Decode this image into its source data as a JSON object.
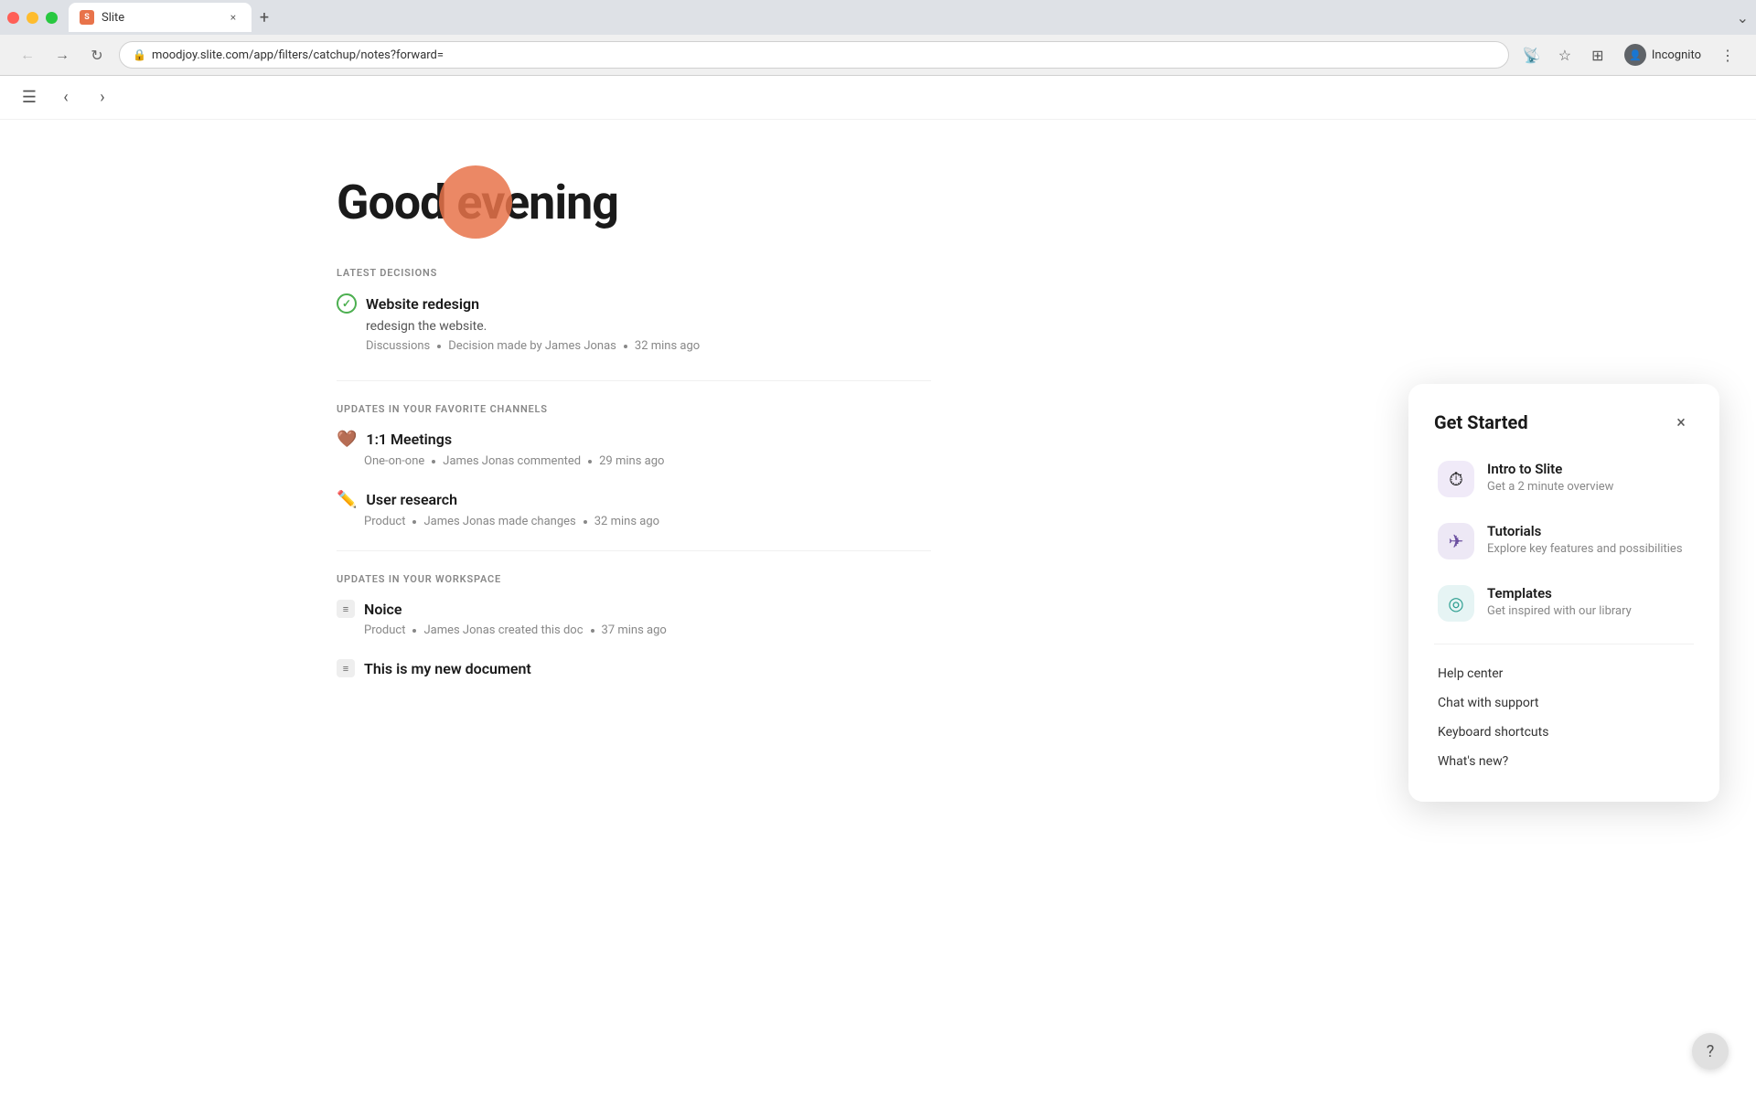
{
  "browser": {
    "tab_label": "Slite",
    "url": "moodjoy.slite.com/app/filters/catchup/notes?forward=",
    "incognito_label": "Incognito"
  },
  "app_toolbar": {
    "sidebar_icon": "☰",
    "back_icon": "‹",
    "forward_icon": "›"
  },
  "main": {
    "greeting": "Good evening",
    "deco_circle_color": "#e8734a",
    "sections": {
      "latest_decisions": {
        "label": "LATEST DECISIONS",
        "items": [
          {
            "title": "Website redesign",
            "description": "redesign the website.",
            "meta1": "Discussions",
            "meta2": "Decision made by James Jonas",
            "time": "32 mins ago"
          }
        ]
      },
      "favorite_channels": {
        "label": "UPDATES IN YOUR FAVORITE CHANNELS",
        "items": [
          {
            "emoji": "🤎",
            "title": "1:1 Meetings",
            "meta1": "One-on-one",
            "meta2": "James Jonas commented",
            "time": "29 mins ago"
          },
          {
            "emoji": "✏️",
            "title": "User research",
            "meta1": "Product",
            "meta2": "James Jonas made changes",
            "time": "32 mins ago"
          }
        ]
      },
      "workspace": {
        "label": "UPDATES IN YOUR WORKSPACE",
        "items": [
          {
            "title": "Noice",
            "meta1": "Product",
            "meta2": "James Jonas created this doc",
            "time": "37 mins ago"
          },
          {
            "title": "This is my new document",
            "meta1": "",
            "meta2": "",
            "time": ""
          }
        ]
      }
    }
  },
  "get_started_panel": {
    "title": "Get Started",
    "close_label": "×",
    "items": [
      {
        "icon": "⏱",
        "icon_bg": "purple",
        "title": "Intro to Slite",
        "description": "Get a 2 minute overview"
      },
      {
        "icon": "✈",
        "icon_bg": "violet",
        "title": "Tutorials",
        "description": "Explore key features and possibilities"
      },
      {
        "icon": "◎",
        "icon_bg": "teal",
        "title": "Templates",
        "description": "Get inspired with our library"
      }
    ],
    "links": [
      {
        "label": "Help center"
      },
      {
        "label": "Chat with support"
      },
      {
        "label": "Keyboard shortcuts"
      },
      {
        "label": "What's new?"
      }
    ]
  }
}
